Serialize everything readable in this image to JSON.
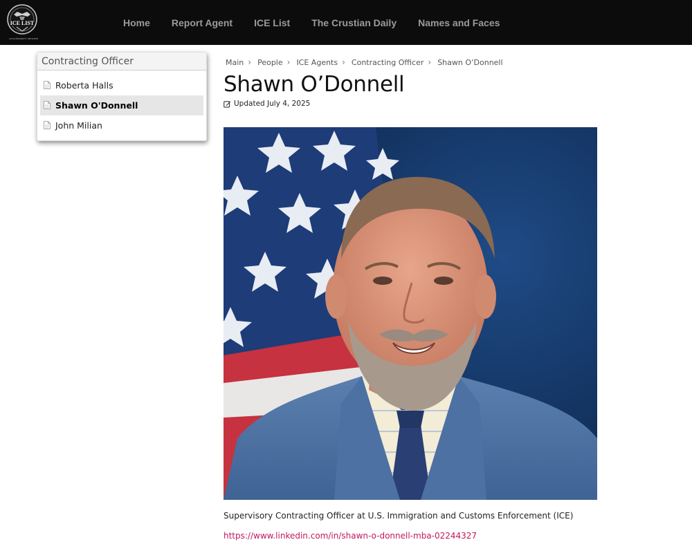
{
  "brand": {
    "logo_text": "ICE LIST",
    "logo_tagline": "ACCOUNTABILITY INITIATIVE"
  },
  "nav": {
    "items": [
      {
        "label": "Home"
      },
      {
        "label": "Report Agent"
      },
      {
        "label": "ICE List"
      },
      {
        "label": "The Crustian Daily"
      },
      {
        "label": "Names and Faces"
      }
    ]
  },
  "sidebar": {
    "title": "Contracting Officer",
    "items": [
      {
        "label": "Roberta Halls",
        "icon": "document-icon"
      },
      {
        "label": "Shawn O'Donnell",
        "icon": "document-icon",
        "active": true
      },
      {
        "label": "John Milian",
        "icon": "document-icon"
      }
    ]
  },
  "breadcrumb": {
    "items": [
      {
        "label": "Main"
      },
      {
        "label": "People"
      },
      {
        "label": "ICE Agents"
      },
      {
        "label": "Contracting Officer"
      },
      {
        "label": "Shawn O’Donnell"
      }
    ],
    "separator": "›"
  },
  "page": {
    "title": "Shawn O’Donnell",
    "updated": "Updated July 4, 2025",
    "bio": "Supervisory Contracting Officer at U.S. Immigration and Customs Enforcement (ICE)",
    "link": "https://www.linkedin.com/in/shawn-o-donnell-mba-02244327"
  },
  "colors": {
    "navbar_bg": "#0c0c0c",
    "nav_text": "#9b9b9b",
    "link": "#c2185b",
    "active_item_bg": "#e6e6e6"
  }
}
